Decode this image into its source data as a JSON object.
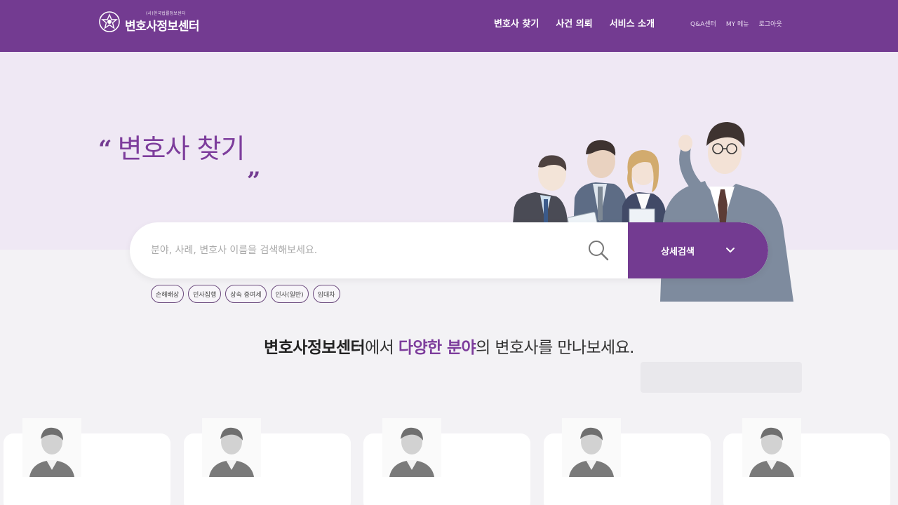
{
  "header": {
    "logo_subtitle": "(사)한국법률정보센터",
    "logo_name": "변호사정보센터",
    "nav_main": [
      "변호사 찾기",
      "사건 의뢰",
      "서비스 소개"
    ],
    "nav_util": [
      "Q&A센터",
      "MY 메뉴",
      "로그아웃"
    ]
  },
  "hero": {
    "quote_open": "“",
    "title": "변호사 찾기",
    "quote_close": "„"
  },
  "search": {
    "placeholder": "분야, 사례, 변호사 이름을 검색해보세요.",
    "detail_button": "상세검색",
    "tags": [
      "손해배상",
      "민사집행",
      "상속 증여세",
      "인사(일반)",
      "임대차"
    ]
  },
  "headline": {
    "part1": "변호사정보센터",
    "part2": "에서 ",
    "part3": "다양한 분야",
    "part4": "의 변호사를 만나보세요."
  },
  "lawyer_cards": [
    "lawyer-1",
    "lawyer-2",
    "lawyer-3",
    "lawyer-4",
    "lawyer-5"
  ],
  "colors": {
    "brand_purple": "#733b91",
    "hero_bg": "#efe8f4",
    "title_purple": "#7d3d9c"
  }
}
